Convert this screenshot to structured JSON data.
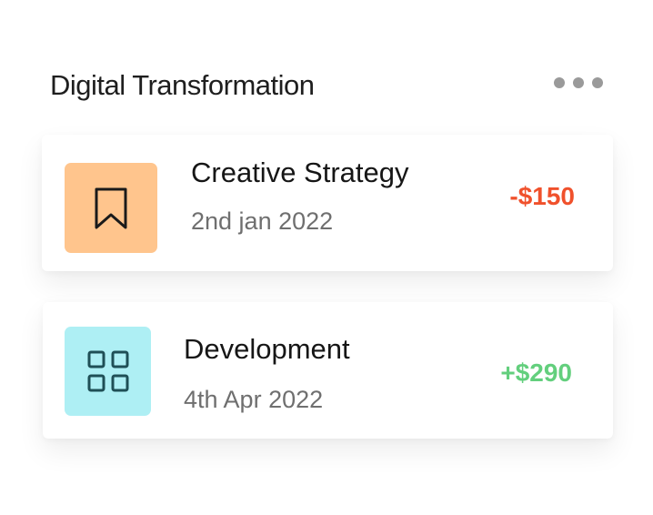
{
  "header": {
    "title": "Digital Transformation",
    "more_icon": "more-horizontal-icon"
  },
  "transactions": [
    {
      "title": "Creative Strategy",
      "date": "2nd jan 2022",
      "amount": "-$150",
      "icon": "bookmark-icon",
      "icon_bg": "#ffc58d",
      "amount_color": "#f0512c"
    },
    {
      "title": "Development",
      "date": "4th Apr 2022",
      "amount": "+$290",
      "icon": "grid-icon",
      "icon_bg": "#aeeff4",
      "amount_color": "#63cf7d"
    }
  ]
}
